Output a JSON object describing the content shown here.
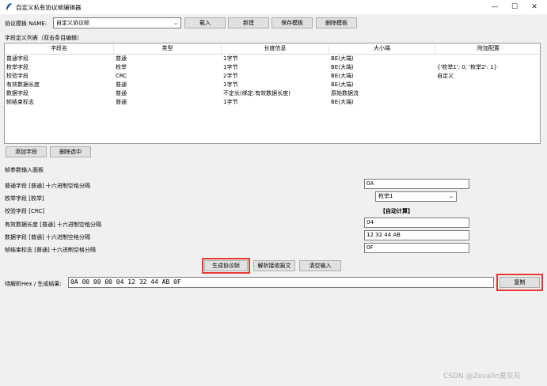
{
  "window": {
    "title": "自定义私有协议帧编辑器",
    "min": "—",
    "max": "☐",
    "close": "✕"
  },
  "template": {
    "label": "协议模板 NAME:",
    "selected": "自定义协议帧",
    "load": "载入",
    "new": "新建",
    "save": "保存模板",
    "delete": "删除模板"
  },
  "fields_section": {
    "label": "字段定义列表（双击条目编辑）",
    "columns": [
      "字段名",
      "类型",
      "长度信息",
      "大小端",
      "附加配置"
    ],
    "rows": [
      [
        "普通字段",
        "普通",
        "1字节",
        "BE(大端)",
        ""
      ],
      [
        "枚举字段",
        "枚举",
        "1字节",
        "BE(大端)",
        "{'枚举1': 0, '枚举2': 1}"
      ],
      [
        "校验字段",
        "CRC",
        "2字节",
        "BE(大端)",
        "自定义"
      ],
      [
        "有效数据长度",
        "普通",
        "1字节",
        "BE(大端)",
        ""
      ],
      [
        "数据字段",
        "普通",
        "不定长(绑定:有效数据长度)",
        "原始数据流",
        ""
      ],
      [
        "帧结束标志",
        "普通",
        "1字节",
        "BE(大端)",
        ""
      ]
    ],
    "add": "添加字段",
    "remove": "删除选中"
  },
  "params": {
    "title": "帧参数输入面板",
    "p1": {
      "label": "普通字段 [普通] 十六进制空格分隔",
      "value": "0A"
    },
    "p2": {
      "label": "枚举字段 [枚举]",
      "value": "枚举1"
    },
    "p3": {
      "label": "校验字段 [CRC]",
      "value": "【自动计算】"
    },
    "p4": {
      "label": "有效数据长度 [普通] 十六进制空格分隔",
      "value": "04"
    },
    "p5": {
      "label": "数据字段 [普通] 十六进制空格分隔",
      "value": "12 32 44 AB"
    },
    "p6": {
      "label": "帧结束标志 [普通] 十六进制空格分隔",
      "value": "0F"
    }
  },
  "actions": {
    "generate": "生成协议帧",
    "parse": "解析接收报文",
    "clear": "清空输入"
  },
  "result": {
    "label": "待解析Hex / 生成结果:",
    "value": "0A 00 00 00 04 12 32 44 AB 0F",
    "copy": "复制"
  },
  "watermark": "CSDN @Zevalin爱灰灰"
}
